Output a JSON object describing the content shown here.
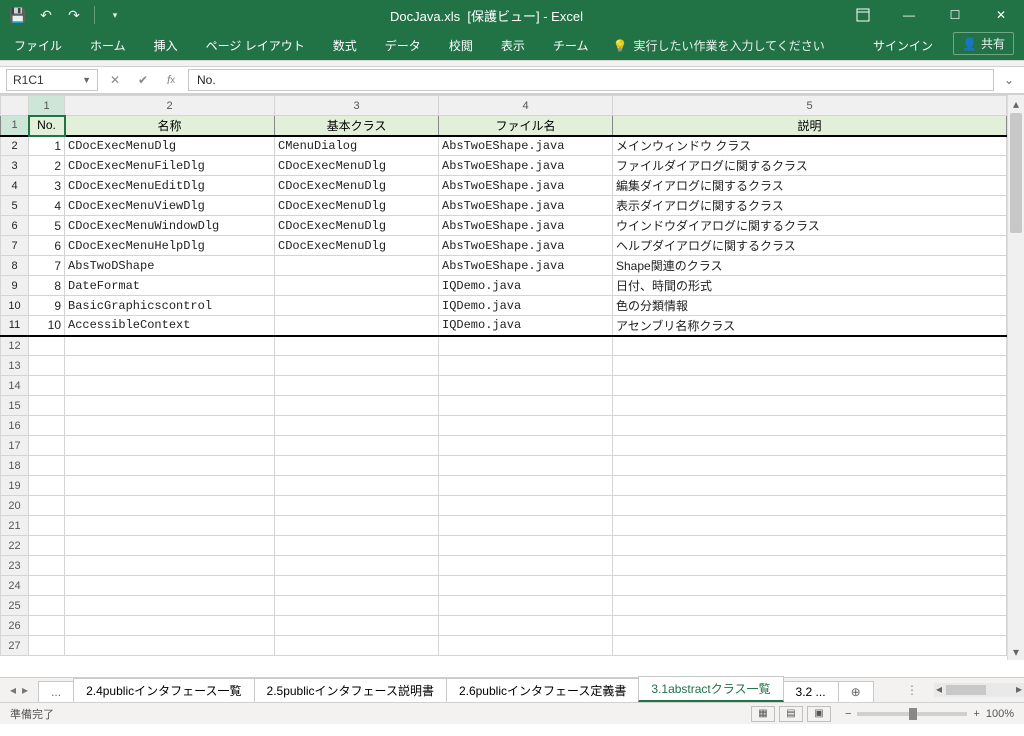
{
  "title": {
    "filename": "DocJava.xls",
    "mode": "[保護ビュー]",
    "app": "Excel"
  },
  "ribbon": {
    "tabs": [
      "ファイル",
      "ホーム",
      "挿入",
      "ページ レイアウト",
      "数式",
      "データ",
      "校閲",
      "表示",
      "チーム"
    ],
    "tell_me": "実行したい作業を入力してください",
    "signin": "サインイン",
    "share": "共有"
  },
  "namebox": "R1C1",
  "formula": "No.",
  "col_headers": [
    "1",
    "2",
    "3",
    "4",
    "5"
  ],
  "header_row": {
    "no": "No.",
    "name": "名称",
    "base": "基本クラス",
    "file": "ファイル名",
    "desc": "説明"
  },
  "rows": [
    {
      "no": "1",
      "name": "CDocExecMenuDlg",
      "base": "CMenuDialog",
      "file": "AbsTwoEShape.java",
      "desc": "メインウィンドウ クラス"
    },
    {
      "no": "2",
      "name": "CDocExecMenuFileDlg",
      "base": "CDocExecMenuDlg",
      "file": "AbsTwoEShape.java",
      "desc": "ファイルダイアログに関するクラス"
    },
    {
      "no": "3",
      "name": "CDocExecMenuEditDlg",
      "base": "CDocExecMenuDlg",
      "file": "AbsTwoEShape.java",
      "desc": "編集ダイアログに関するクラス"
    },
    {
      "no": "4",
      "name": "CDocExecMenuViewDlg",
      "base": "CDocExecMenuDlg",
      "file": "AbsTwoEShape.java",
      "desc": "表示ダイアログに関するクラス"
    },
    {
      "no": "5",
      "name": "CDocExecMenuWindowDlg",
      "base": "CDocExecMenuDlg",
      "file": "AbsTwoEShape.java",
      "desc": "ウインドウダイアログに関するクラス"
    },
    {
      "no": "6",
      "name": "CDocExecMenuHelpDlg",
      "base": "CDocExecMenuDlg",
      "file": "AbsTwoEShape.java",
      "desc": "ヘルプダイアログに関するクラス"
    },
    {
      "no": "7",
      "name": "AbsTwoDShape",
      "base": "",
      "file": "AbsTwoEShape.java",
      "desc": "Shape関連のクラス"
    },
    {
      "no": "8",
      "name": "DateFormat",
      "base": "",
      "file": "IQDemo.java",
      "desc": "日付、時間の形式"
    },
    {
      "no": "9",
      "name": "BasicGraphicscontrol",
      "base": "",
      "file": "IQDemo.java",
      "desc": "色の分類情報"
    },
    {
      "no": "10",
      "name": "AccessibleContext",
      "base": "",
      "file": "IQDemo.java",
      "desc": "アセンブリ名称クラス"
    }
  ],
  "empty_rows": 16,
  "sheets": {
    "tabs": [
      "2.4publicインタフェース一覧",
      "2.5publicインタフェース説明書",
      "2.6publicインタフェース定義書",
      "3.1abstractクラス一覧",
      "3.2 ..."
    ],
    "active_index": 3,
    "left_ellipsis": "..."
  },
  "status": {
    "ready": "準備完了",
    "zoom": "100%"
  },
  "icons": {
    "bulb": "💡",
    "person": "👤"
  }
}
